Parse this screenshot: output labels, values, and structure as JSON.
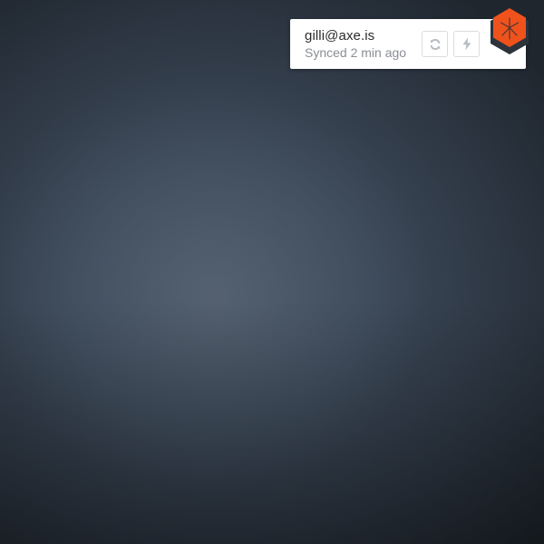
{
  "account": {
    "email": "gilli@axe.is",
    "sync_status": "Synced 2 min ago"
  },
  "icons": {
    "sync": "sync-icon",
    "power": "lightning-icon",
    "logo": "hexagon-logo"
  },
  "colors": {
    "logo_orange": "#f0521c",
    "logo_dark": "#2c333b",
    "icon_gray": "#b7bcc2"
  }
}
